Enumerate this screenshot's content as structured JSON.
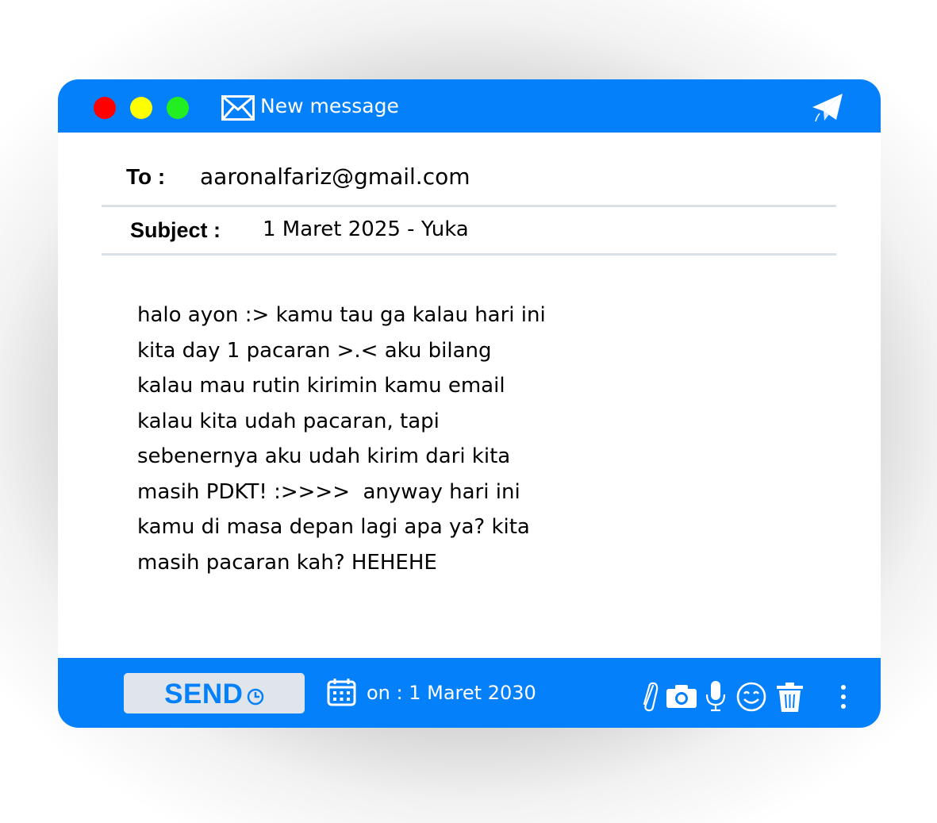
{
  "window": {
    "title": "New message",
    "buttons": {
      "close_color": "#ff0000",
      "minimize_color": "#ffff00",
      "maximize_color": "#22ee22"
    },
    "icons": [
      "mail-icon",
      "paper-plane-icon"
    ]
  },
  "compose": {
    "to_label": "To :",
    "to_value": "aaronalfariz@gmail.com",
    "subject_label": "Subject :",
    "subject_value": "1 Maret 2025 - Yuka",
    "body_lines": [
      "halo ayon :> kamu tau ga kalau hari ini",
      "kita day 1 pacaran >.< aku bilang",
      "kalau mau rutin kirimin kamu email",
      "kalau kita udah pacaran, tapi",
      "sebenernya aku udah kirim dari kita",
      "masih PDKT! :>>>>  anyway hari ini",
      "kamu di masa depan lagi apa ya? kita",
      "masih pacaran kah? HEHEHE"
    ]
  },
  "footer": {
    "send_label": "SEND",
    "schedule_text": "on : 1 Maret 2030",
    "icons": [
      "clock-icon",
      "calendar-icon",
      "paperclip-icon",
      "camera-icon",
      "microphone-icon",
      "emoji-icon",
      "trash-icon",
      "more-icon"
    ]
  },
  "colors": {
    "accent": "#0580fb",
    "send_button_bg": "#dfe5ea",
    "divider": "#d9e1e6"
  }
}
